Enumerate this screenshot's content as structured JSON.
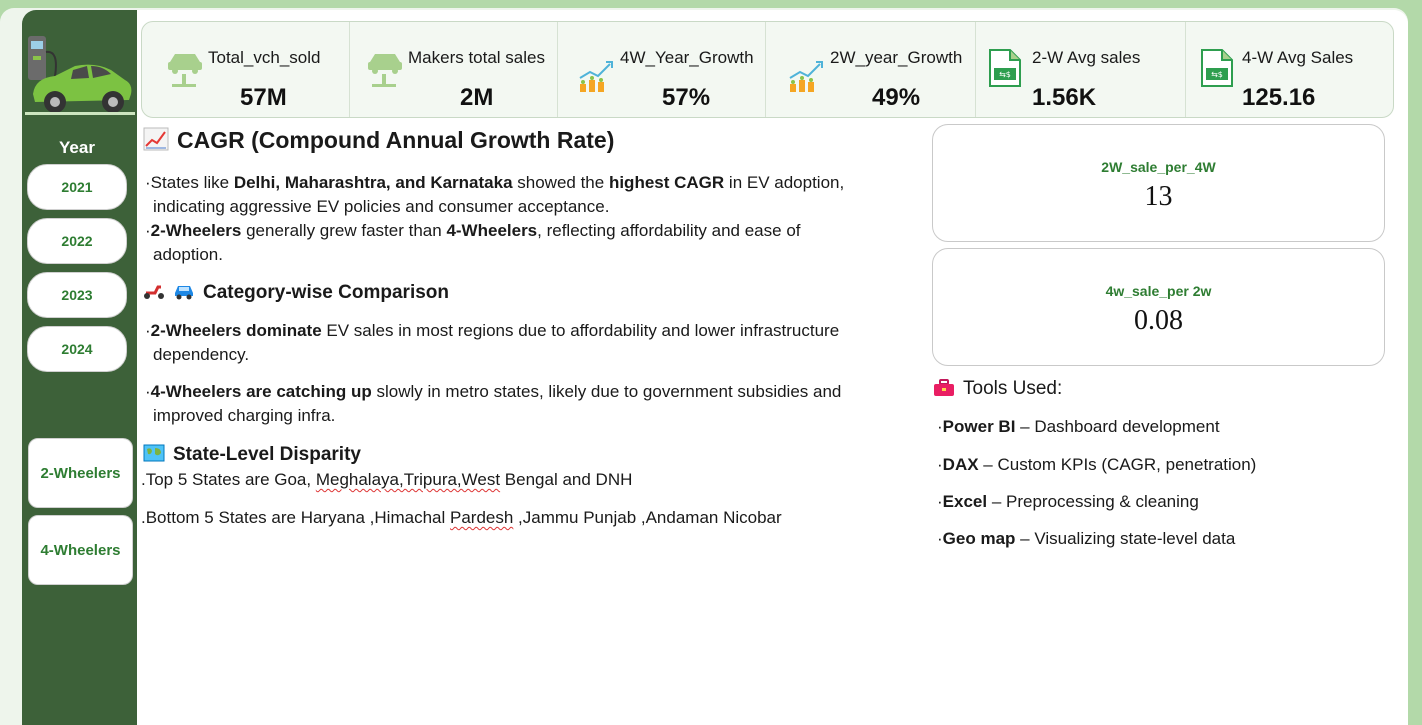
{
  "kpis": [
    {
      "label": "Total_vch_sold",
      "value": "57M",
      "icon": "car-lift-icon"
    },
    {
      "label": "Makers total sales",
      "value": "2M",
      "icon": "car-lift-icon"
    },
    {
      "label": "4W_Year_Growth",
      "value": "57%",
      "icon": "growth-coins-icon"
    },
    {
      "label": "2W_year_Growth",
      "value": "49%",
      "icon": "growth-coins-icon"
    },
    {
      "label": "2-W Avg sales",
      "value": "1.56K",
      "icon": "exchange-document-icon"
    },
    {
      "label": "4-W Avg Sales",
      "value": "125.16",
      "icon": "exchange-document-icon"
    }
  ],
  "sidebar": {
    "year_title": "Year",
    "years": [
      "2021",
      "2022",
      "2023",
      "2024"
    ],
    "categories": [
      "2-Wheelers",
      "4-Wheelers"
    ]
  },
  "insights": {
    "cagr_title": "CAGR (Compound Annual Growth Rate)",
    "cagr_p1": {
      "t1": "States like ",
      "b1": "Delhi, Maharashtra, and Karnataka",
      "t2": " showed the ",
      "b2": "highest CAGR",
      "t3": " in EV adoption,",
      "t4": "indicating aggressive EV policies and consumer acceptance."
    },
    "cagr_p2": {
      "b1": "2-Wheelers",
      "t1": " generally grew faster than ",
      "b2": "4-Wheelers",
      "t2": ", reflecting affordability and ease of",
      "t3": "adoption."
    },
    "category_title": "Category-wise Comparison",
    "cat_p1": {
      "b1": "2-Wheelers dominate",
      "t1": " EV sales in most regions due to affordability and lower infrastructure",
      "t2": "dependency."
    },
    "cat_p2": {
      "b1": "4-Wheelers are catching up",
      "t1": " slowly in metro states, likely due to government subsidies and",
      "t2": "improved charging infra."
    },
    "state_title": "State-Level Disparity",
    "top5": {
      "t1": ".Top 5 States are  Goa, ",
      "s1": "Meghalaya,Tripura,West",
      "t2": " Bengal and DNH"
    },
    "bottom5": {
      "t1": ".Bottom 5 States are Haryana ,Himachal ",
      "s1": "Pardesh",
      "t2": " ,Jammu Punjab ,Andaman Nicobar"
    }
  },
  "ratios": [
    {
      "label": "2W_sale_per_4W",
      "value": "13"
    },
    {
      "label": "4w_sale_per 2w",
      "value": "0.08"
    }
  ],
  "tools": {
    "title": "Tools Used:",
    "items": [
      {
        "name": "Power BI",
        "desc": " – Dashboard development"
      },
      {
        "name": "DAX",
        "desc": " – Custom KPIs (CAGR, penetration)"
      },
      {
        "name": "Excel",
        "desc": " – Preprocessing & cleaning"
      },
      {
        "name": "Geo map",
        "desc": " – Visualizing state-level data"
      }
    ]
  },
  "colors": {
    "sidebar": "#3d6139",
    "accent_green": "#2e7d32",
    "page_bg": "#b3d9a9"
  }
}
